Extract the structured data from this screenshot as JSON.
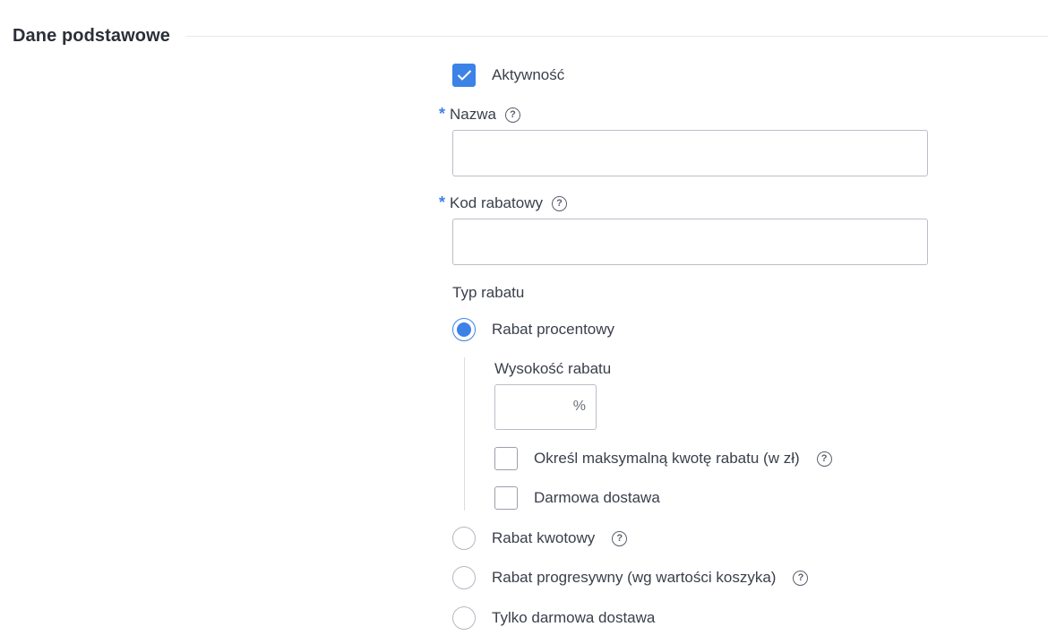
{
  "section": {
    "title": "Dane podstawowe"
  },
  "active": {
    "label": "Aktywność",
    "checked": true
  },
  "name_field": {
    "required_mark": "*",
    "label": "Nazwa",
    "help": "?",
    "value": "",
    "placeholder": ""
  },
  "code_field": {
    "required_mark": "*",
    "label": "Kod rabatowy",
    "help": "?",
    "value": "",
    "placeholder": ""
  },
  "discount_type": {
    "label": "Typ rabatu",
    "options": [
      {
        "label": "Rabat procentowy",
        "selected": true
      },
      {
        "label": "Rabat kwotowy",
        "selected": false,
        "help": "?"
      },
      {
        "label": "Rabat progresywny (wg wartości koszyka)",
        "selected": false,
        "help": "?"
      },
      {
        "label": "Tylko darmowa dostawa",
        "selected": false
      }
    ]
  },
  "percent_options": {
    "amount_label": "Wysokość rabatu",
    "amount_value": "",
    "unit": "%",
    "max_amount": {
      "label": "Określ maksymalną kwotę rabatu (w zł)",
      "checked": false,
      "help": "?"
    },
    "free_shipping": {
      "label": "Darmowa dostawa",
      "checked": false
    }
  },
  "colors": {
    "accent": "#3d82e6",
    "border": "#b9bec7",
    "text": "#3a3f4b"
  }
}
